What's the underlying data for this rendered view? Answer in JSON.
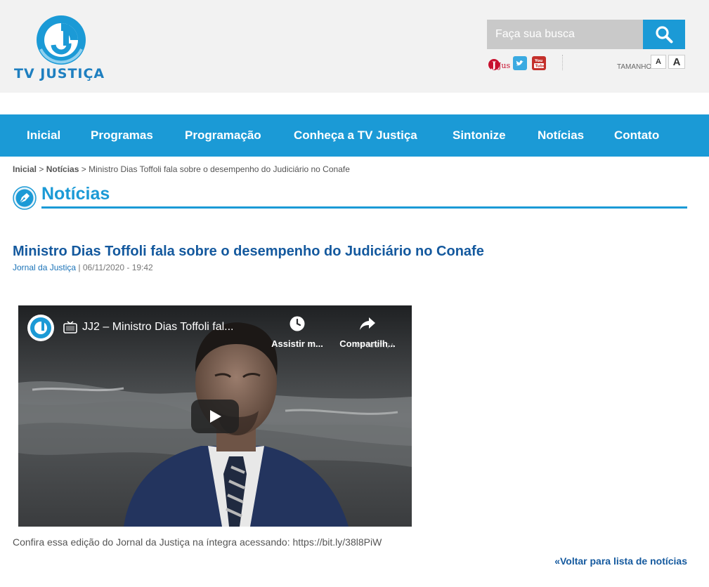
{
  "header": {
    "logo_text": "TV JUSTIÇA",
    "search": {
      "placeholder": "Faça sua busca"
    },
    "social": {
      "jus_label": "Jus",
      "youtube_label": "You Tube"
    },
    "font_size": {
      "label": "TAMANHO",
      "small": "A",
      "large": "A"
    }
  },
  "nav": {
    "items": [
      {
        "label": "Inicial"
      },
      {
        "label": "Programas"
      },
      {
        "label": "Programação"
      },
      {
        "label": "Conheça a TV Justiça"
      },
      {
        "label": "Sintonize"
      },
      {
        "label": "Notícias"
      },
      {
        "label": "Contato"
      }
    ]
  },
  "breadcrumb": {
    "home": "Inicial",
    "section": "Notícias",
    "separator": ">",
    "current": "Ministro Dias Toffoli fala sobre o desempenho do Judiciário no Conafe"
  },
  "section": {
    "title": "Notícias"
  },
  "article": {
    "title": "Ministro Dias Toffoli fala sobre o desempenho do Judiciário no Conafe",
    "program": "Jornal da Justiça",
    "meta_separator": "|",
    "datetime": "06/11/2020 - 19:42",
    "caption": "Confira essa edição do Jornal da Justiça na íntegra acessando: https://bit.ly/38l8PiW",
    "back_link": "«Voltar para lista de notícias"
  },
  "video": {
    "title": "JJ2 – Ministro Dias Toffoli fal...",
    "watch_later": "Assistir m...",
    "share": "Compartilh...",
    "watermark": "TV JUSTIÇA"
  },
  "colors": {
    "brand_blue": "#1b9ad6",
    "title_blue": "#14599e",
    "header_bg": "#f2f2f2"
  }
}
